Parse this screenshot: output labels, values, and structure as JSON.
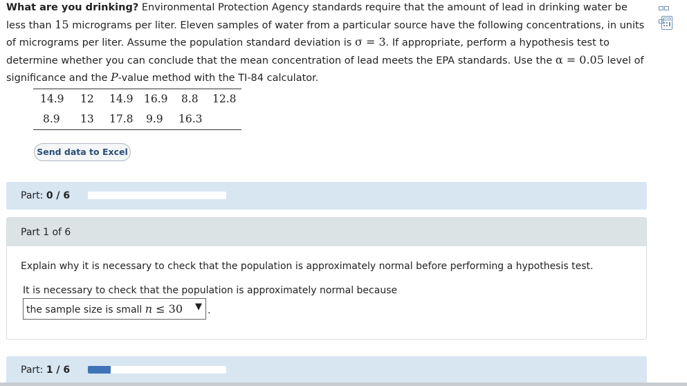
{
  "problem": {
    "title": "What are you drinking?",
    "text_1": " Environmental Protection Agency standards require that the amount of lead in drinking water be less than ",
    "num_15": "15",
    "text_2": " micrograms per liter. Eleven samples of water from a particular source have the following concentrations, in units of micrograms per liter. Assume the population standard deviation is ",
    "sigma_expr": "σ = 3",
    "text_3": ". If appropriate, perform a hypothesis test to determine whether you can conclude that the mean concentration of lead meets the EPA standards. Use the ",
    "alpha_expr": "α = 0.05",
    "text_4": " level of significance and the ",
    "p_italic": "P",
    "text_5": "-value method with the TI-84 calculator."
  },
  "data_table": {
    "row1": [
      "14.9",
      "12",
      "14.9",
      "16.9",
      "8.8",
      "12.8"
    ],
    "row2": [
      "8.9",
      "13",
      "17.8",
      "9.9",
      "16.3"
    ]
  },
  "excel_button": "Send data to Excel",
  "part_progress_top": {
    "label": "Part:",
    "value": "0 / 6",
    "fraction": 0
  },
  "part1": {
    "header": "Part 1 of 6",
    "question": "Explain why it is necessary to check that the population is approximately normal before performing a hypothesis test.",
    "prompt": "It is necessary to check that the population is approximately normal because",
    "select_text": "the sample size is small ",
    "select_math_n": "n",
    "select_math_rest": " ≤ 30",
    "select_arrow": "▼",
    "period": "."
  },
  "part_progress_bottom": {
    "label": "Part:",
    "value": "1 / 6",
    "fraction": 0.1667
  }
}
